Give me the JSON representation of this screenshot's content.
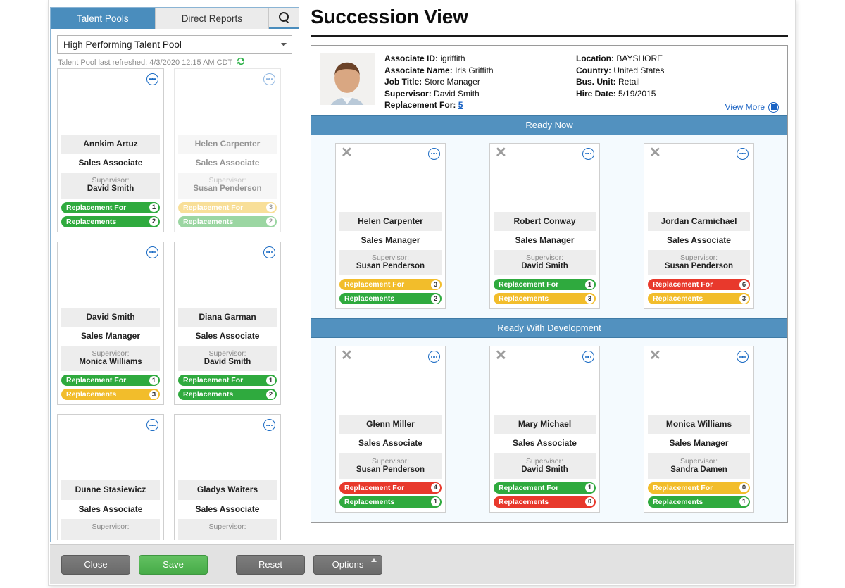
{
  "page": {
    "title": "Succession View"
  },
  "sidebar": {
    "tabs": [
      {
        "label": "Talent Pools",
        "active": true
      },
      {
        "label": "Direct Reports",
        "active": false
      }
    ],
    "search_icon": "search-icon",
    "pool_select": {
      "value": "High Performing Talent Pool",
      "caret_icon": "chevron-down-icon"
    },
    "refresh_text": "Talent Pool last refreshed: 4/3/2020 12:15 AM CDT",
    "refresh_icon": "refresh-icon",
    "cards": [
      {
        "name": "Annkim Artuz",
        "job_title": "Sales Associate",
        "supervisor_label": "Supervisor:",
        "supervisor": "David Smith",
        "faded": false,
        "badges": [
          {
            "label": "Replacement For",
            "count": "1",
            "color": "green"
          },
          {
            "label": "Replacements",
            "count": "2",
            "color": "green"
          }
        ]
      },
      {
        "name": "Helen Carpenter",
        "job_title": "Sales Associate",
        "supervisor_label": "Supervisor:",
        "supervisor": "Susan Penderson",
        "faded": true,
        "badges": [
          {
            "label": "Replacement For",
            "count": "3",
            "color": "yellow"
          },
          {
            "label": "Replacements",
            "count": "2",
            "color": "green"
          }
        ]
      },
      {
        "name": "David Smith",
        "job_title": "Sales Manager",
        "supervisor_label": "Supervisor:",
        "supervisor": "Monica Williams",
        "faded": false,
        "badges": [
          {
            "label": "Replacement For",
            "count": "1",
            "color": "green"
          },
          {
            "label": "Replacements",
            "count": "3",
            "color": "yellow"
          }
        ]
      },
      {
        "name": "Diana Garman",
        "job_title": "Sales Associate",
        "supervisor_label": "Supervisor:",
        "supervisor": "David Smith",
        "faded": false,
        "badges": [
          {
            "label": "Replacement For",
            "count": "1",
            "color": "green"
          },
          {
            "label": "Replacements",
            "count": "2",
            "color": "green"
          }
        ]
      },
      {
        "name": "Duane Stasiewicz",
        "job_title": "Sales Associate",
        "supervisor_label": "Supervisor:",
        "supervisor": "",
        "faded": false,
        "badges": []
      },
      {
        "name": "Gladys Waiters",
        "job_title": "Sales Associate",
        "supervisor_label": "Supervisor:",
        "supervisor": "",
        "faded": false,
        "badges": []
      }
    ]
  },
  "associate": {
    "left": [
      {
        "label": "Associate ID:",
        "value": "igriffith"
      },
      {
        "label": "Associate Name:",
        "value": "Iris Griffith"
      },
      {
        "label": "Job Title:",
        "value": "Store Manager"
      },
      {
        "label": "Supervisor:",
        "value": "David Smith"
      },
      {
        "label": "Replacement For:",
        "value": "5",
        "link": true
      }
    ],
    "right": [
      {
        "label": "Location:",
        "value": "BAYSHORE"
      },
      {
        "label": "Country:",
        "value": "United States"
      },
      {
        "label": "Bus. Unit:",
        "value": "Retail"
      },
      {
        "label": "Hire Date:",
        "value": "5/19/2015"
      }
    ],
    "view_more": "View More",
    "view_more_icon": "menu-circle-icon"
  },
  "sections": [
    {
      "band": "Ready Now",
      "cards": [
        {
          "name": "Helen Carpenter",
          "job_title": "Sales Manager",
          "supervisor_label": "Supervisor:",
          "supervisor": "Susan Penderson",
          "badges": [
            {
              "label": "Replacement For",
              "count": "3",
              "color": "yellow"
            },
            {
              "label": "Replacements",
              "count": "2",
              "color": "green"
            }
          ]
        },
        {
          "name": "Robert Conway",
          "job_title": "Sales Manager",
          "supervisor_label": "Supervisor:",
          "supervisor": "David Smith",
          "badges": [
            {
              "label": "Replacement For",
              "count": "1",
              "color": "green"
            },
            {
              "label": "Replacements",
              "count": "3",
              "color": "yellow"
            }
          ]
        },
        {
          "name": "Jordan Carmichael",
          "job_title": "Sales Associate",
          "supervisor_label": "Supervisor:",
          "supervisor": "Susan Penderson",
          "badges": [
            {
              "label": "Replacement For",
              "count": "6",
              "color": "red"
            },
            {
              "label": "Replacements",
              "count": "3",
              "color": "yellow"
            }
          ]
        }
      ]
    },
    {
      "band": "Ready With Development",
      "cards": [
        {
          "name": "Glenn Miller",
          "job_title": "Sales Associate",
          "supervisor_label": "Supervisor:",
          "supervisor": "Susan Penderson",
          "badges": [
            {
              "label": "Replacement For",
              "count": "4",
              "color": "red"
            },
            {
              "label": "Replacements",
              "count": "1",
              "color": "green"
            }
          ]
        },
        {
          "name": "Mary Michael",
          "job_title": "Sales Associate",
          "supervisor_label": "Supervisor:",
          "supervisor": "David Smith",
          "badges": [
            {
              "label": "Replacement For",
              "count": "1",
              "color": "green"
            },
            {
              "label": "Replacements",
              "count": "0",
              "color": "red"
            }
          ]
        },
        {
          "name": "Monica Williams",
          "job_title": "Sales Manager",
          "supervisor_label": "Supervisor:",
          "supervisor": "Sandra Damen",
          "badges": [
            {
              "label": "Replacement For",
              "count": "0",
              "color": "yellow"
            },
            {
              "label": "Replacements",
              "count": "1",
              "color": "green"
            }
          ]
        }
      ]
    }
  ],
  "footer": {
    "buttons": [
      {
        "label": "Close",
        "style": "grey"
      },
      {
        "label": "Save",
        "style": "green"
      },
      {
        "label": "Reset",
        "style": "grey"
      },
      {
        "label": "Options",
        "style": "grey",
        "caret": true
      }
    ]
  },
  "colors": {
    "tab_active": "#4a8dbd",
    "band": "#5291bf",
    "badge_green": "#2faa3e",
    "badge_yellow": "#f2bd2b",
    "badge_red": "#e8392c",
    "link": "#1a63c4",
    "save": "#46ab47"
  }
}
